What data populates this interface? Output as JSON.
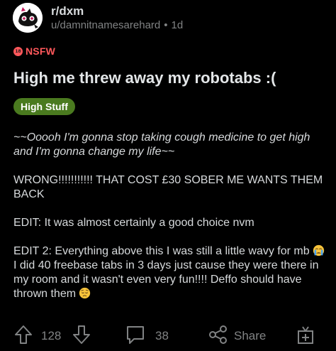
{
  "post": {
    "subreddit": "r/dxm",
    "author": "u/damnitnamesarehard",
    "separator": "•",
    "age": "1d",
    "nsfw_label": "NSFW",
    "nsfw_badge": "18",
    "title": "High me threw away my robotabs :(",
    "flair": "High Stuff",
    "body": {
      "p1": "~~Ooooh I'm gonna stop taking cough medicine to get high and I'm gonna change my life~~",
      "p2": "WRONG!!!!!!!!!!! THAT COST £30 SOBER ME WANTS THEM BACK",
      "p3": "EDIT: It was almost certainly a good choice nvm",
      "p4a": "EDIT 2: Everything above this I was still a little wavy for mb ",
      "p4b": " I did 40 freebase tabs in 3 days just cause they were there in my room and it wasn't even very fun!!!! Deffo should have thrown them "
    }
  },
  "footer": {
    "upvotes": "128",
    "comments": "38",
    "share_label": "Share"
  },
  "colors": {
    "background": "#000000",
    "nsfw": "#ff585b",
    "flair": "#4a7a1f",
    "muted": "#818384"
  },
  "icons": [
    "avatar-cat-icon",
    "nsfw-icon",
    "upvote-icon",
    "downvote-icon",
    "comment-icon",
    "share-icon",
    "award-icon",
    "crying-emoji-icon",
    "pensive-emoji-icon"
  ]
}
